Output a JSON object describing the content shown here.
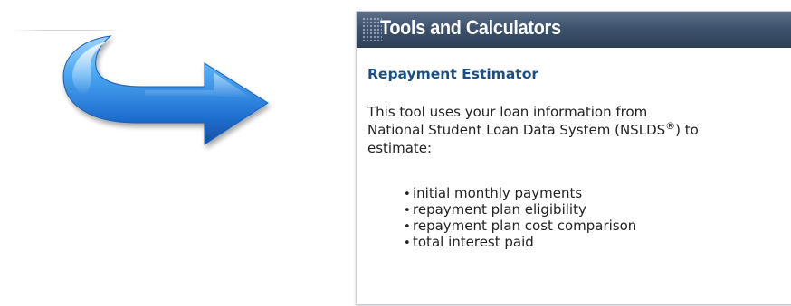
{
  "panel": {
    "title": "Tools and Calculators",
    "tool": {
      "name": "Repayment Estimator",
      "description_line1": "This tool uses your loan information from",
      "description_line2_pre": "National Student Loan Data System (NSLDS",
      "description_line2_sup": "®",
      "description_line2_post": ") to",
      "description_line3": "estimate:",
      "bullets": [
        "initial monthly payments",
        "repayment plan eligibility",
        "repayment plan cost comparison",
        "total interest paid"
      ]
    }
  },
  "decor": {
    "arrow_icon": "curved-arrow-right-icon",
    "arrow_color": "#2f8be0",
    "header_color": "#3e526d",
    "tool_name_color": "#1a4f84"
  }
}
